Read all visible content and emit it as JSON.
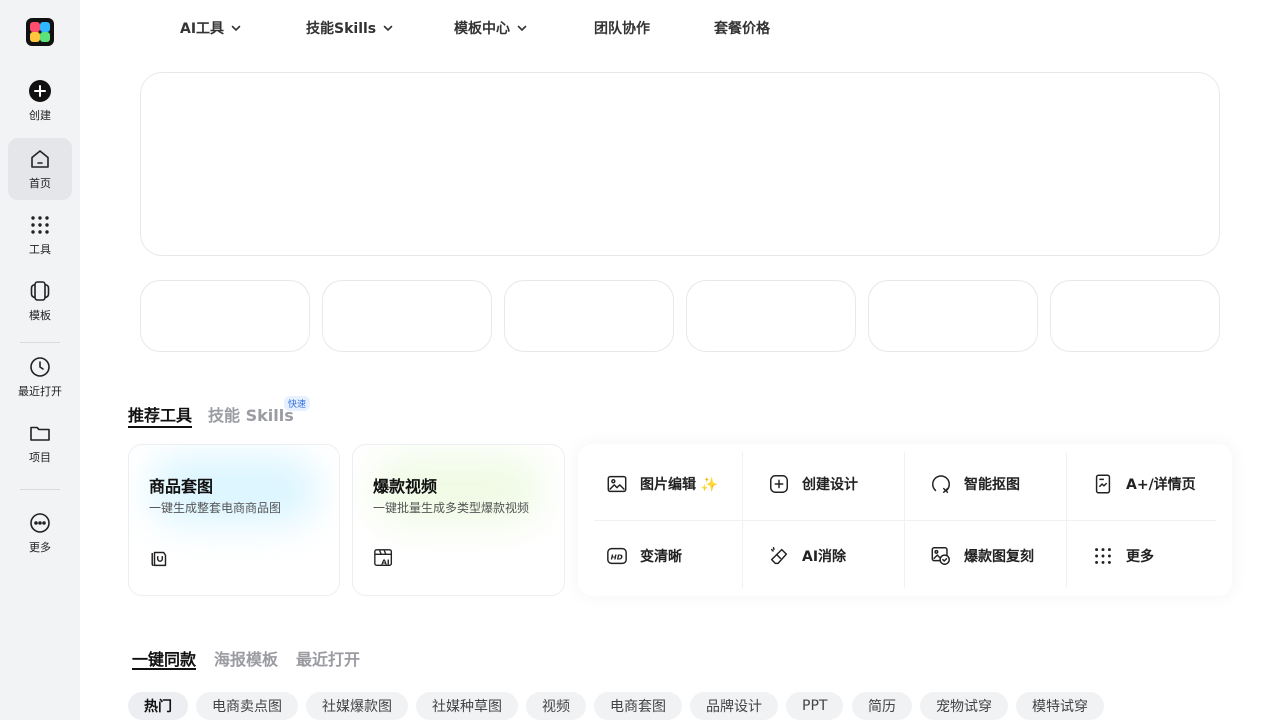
{
  "sidebar": {
    "items": [
      {
        "label": "创建",
        "icon": "plus-circle-icon"
      },
      {
        "label": "首页",
        "icon": "home-icon"
      },
      {
        "label": "工具",
        "icon": "grid-dots-icon"
      },
      {
        "label": "模板",
        "icon": "template-stack-icon"
      },
      {
        "label": "最近打开",
        "icon": "clock-icon"
      },
      {
        "label": "项目",
        "icon": "folder-icon"
      },
      {
        "label": "更多",
        "icon": "more-circle-icon"
      }
    ]
  },
  "topnav": {
    "items": [
      {
        "label": "AI工具"
      },
      {
        "label": "技能Skills"
      },
      {
        "label": "模板中心"
      },
      {
        "label": "团队协作"
      },
      {
        "label": "套餐价格"
      }
    ]
  },
  "tabs": {
    "recommended": "推荐工具",
    "skills": "技能 Skills",
    "skills_badge": "快速"
  },
  "features": [
    {
      "title": "商品套图",
      "subtitle": "一键生成整套电商商品图",
      "icon": "shopping-bag-icon",
      "glow": "#bfeeff"
    },
    {
      "title": "爆款视频",
      "subtitle": "一键批量生成多类型爆款视频",
      "icon": "ai-video-icon",
      "glow": "#e4f7d0"
    }
  ],
  "tools": [
    {
      "label": "图片编辑",
      "suffix": "✨",
      "icon": "image-edit-icon"
    },
    {
      "label": "创建设计",
      "icon": "plus-square-icon"
    },
    {
      "label": "智能抠图",
      "icon": "cutout-icon"
    },
    {
      "label": "A+/详情页",
      "icon": "detail-page-icon"
    },
    {
      "label": "变清晰",
      "icon": "hd-icon"
    },
    {
      "label": "AI消除",
      "icon": "eraser-icon"
    },
    {
      "label": "爆款图复刻",
      "icon": "image-copy-icon"
    },
    {
      "label": "更多",
      "icon": "grid-dots-icon"
    }
  ],
  "lower_tabs": {
    "items": [
      "一键同款",
      "海报模板",
      "最近打开"
    ]
  },
  "filters": [
    "热门",
    "电商卖点图",
    "社媒爆款图",
    "社媒种草图",
    "视频",
    "电商套图",
    "品牌设计",
    "PPT",
    "简历",
    "宠物试穿",
    "模特试穿"
  ]
}
